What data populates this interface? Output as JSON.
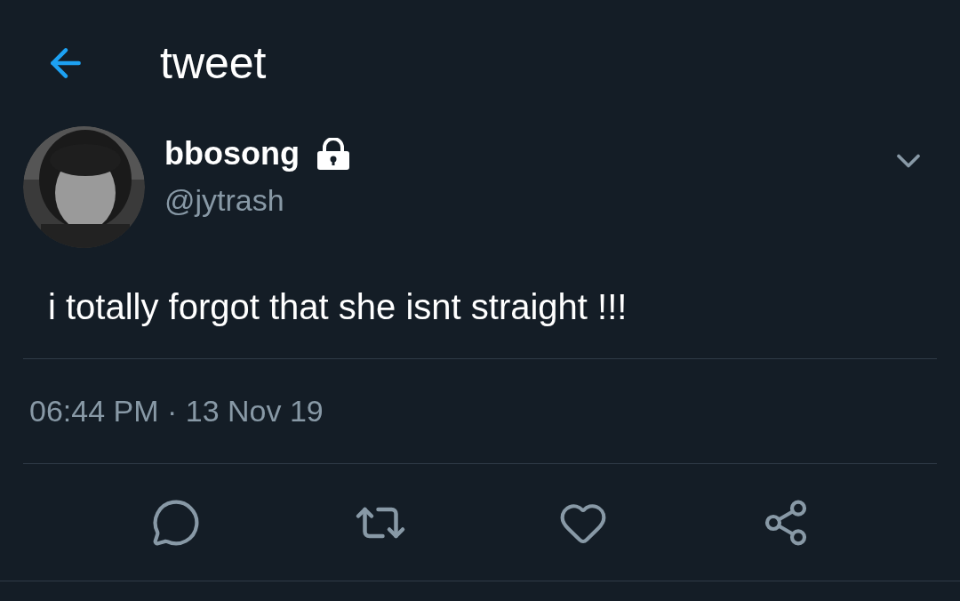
{
  "header": {
    "title": "tweet"
  },
  "tweet": {
    "name": "bbosong",
    "protected": true,
    "handle": "@jytrash",
    "text": "i totally forgot that she isnt straight !!!",
    "timestamp": "06:44 PM · 13 Nov 19"
  }
}
